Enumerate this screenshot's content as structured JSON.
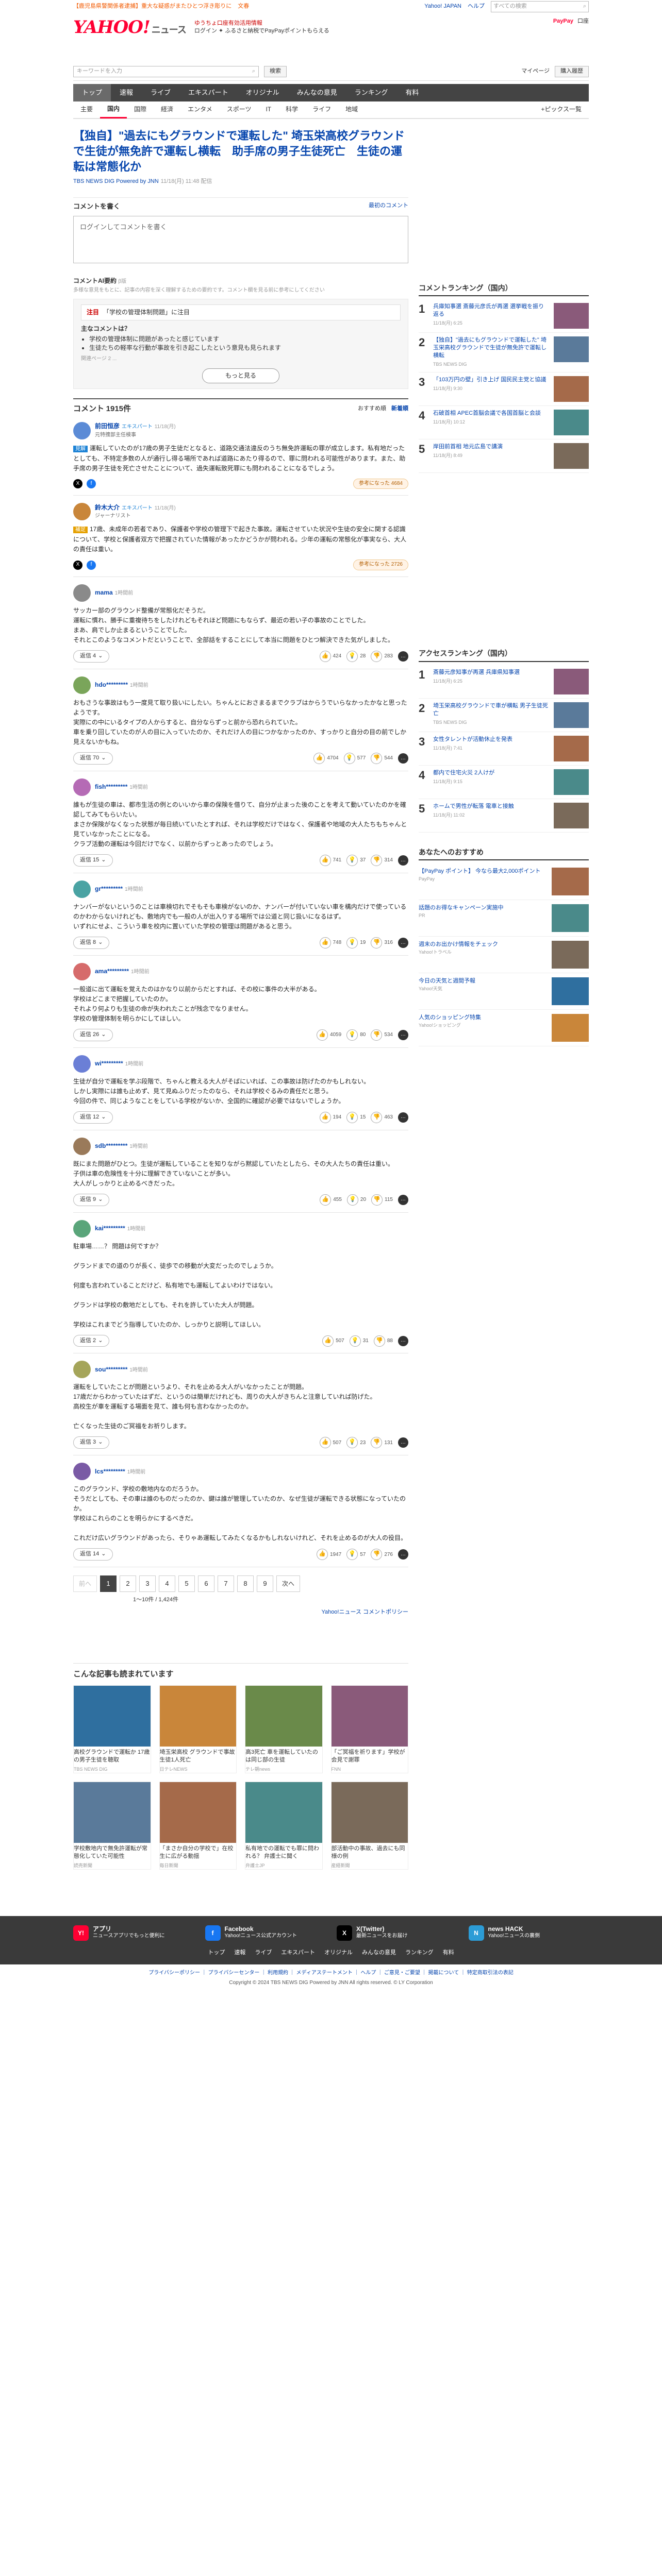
{
  "alert": {
    "items": [
      "【鹿児島県警関係者逮捕】重大な疑惑がまたひとつ浮き彫りに",
      "文春"
    ],
    "yj": "Yahoo! JAPAN",
    "help": "ヘルプ",
    "search_ph": "すべての検索"
  },
  "masthead": {
    "logo": "YAHOO!",
    "logo_sub": "ニュース",
    "promo1": "ゆうちょ口座有効活用情報",
    "promo2": "ログイン  ✦ ふるさと納税でPayPayポイントもらえる",
    "pp": "PayPay",
    "bank": "口座"
  },
  "tools": {
    "search_ph": "キーワードを入力",
    "search_btn": "検索",
    "mypage": "マイページ",
    "hist": "購入履歴"
  },
  "nav": [
    "トップ",
    "速報",
    "ライブ",
    "エキスパート",
    "オリジナル",
    "みんなの意見",
    "ランキング",
    "有料"
  ],
  "subnav": [
    "主要",
    "国内",
    "国際",
    "経済",
    "エンタメ",
    "スポーツ",
    "IT",
    "科学",
    "ライフ",
    "地域"
  ],
  "subnav_more": "+ピックス一覧",
  "article": {
    "title": "【独自】\"過去にもグラウンドで運転した\" 埼玉栄高校グラウンドで生徒が無免許で運転し横転　助手席の男子生徒死亡　生徒の運転は常態化か",
    "source": "TBS NEWS DIG Powered by JNN",
    "date": "11/18(月) 11:48 配信"
  },
  "comment_post": {
    "head": "コメントを書く",
    "rule": "最初のコメント",
    "placeholder": "ログインしてコメントを書く"
  },
  "ai": {
    "head": "コメントAI要約",
    "beta": "β版",
    "sub": "多様な意見をもとに、記事の内容を深く理解するための要約です。コメント欄を見る前に参考にしてください",
    "topic_label": "注目",
    "topic": "「学校の管理体制問題」に注目",
    "points_head": "主なコメントは？",
    "points": [
      "学校の管理体制に問題があったと感じています",
      "生徒たちの軽率な行動が事故を引き起こしたという意見も見られます"
    ],
    "note": "関連ページ 2 ...",
    "more": "もっと見る"
  },
  "comments_header": {
    "title": "コメント",
    "count": "1915件",
    "sort_recommend": "おすすめ順",
    "sort_new": "新着順"
  },
  "comments": [
    {
      "name": "前田恒彦",
      "badge": "エキスパート",
      "time": "11/18(月)",
      "role": "元特捜部主任検事",
      "tag": "見解",
      "text": "運転していたのが17歳の男子生徒だとなると、道路交通法違反のうち無免許運転の罪が成立します。私有地だったとしても、不特定多数の人が通行し得る場所であれば道路にあたり得るので、罪に問われる可能性があります。また、助手席の男子生徒を死亡させたことについて、過失運転致死罪にも問われることになるでしょう。",
      "exp": "専門家コメント",
      "up": "1",
      "mid": "",
      "down": "",
      "reply": "",
      "agree": "参考になった 4684"
    },
    {
      "name": "鈴木大介",
      "badge": "エキスパート",
      "time": "11/18(月)",
      "role": "ジャーナリスト",
      "tag": "補足",
      "text": "17歳、未成年の若者であり、保護者や学校の管理下で起きた事故。運転させていた状況や生徒の安全に関する認識について、学校と保護者双方で把握されていた情報があったかどうかが問われる。少年の運転の常態化が事実なら、大人の責任は重い。",
      "exp": "",
      "up": "",
      "mid": "",
      "down": "",
      "reply": "",
      "agree": "参考になった 2726"
    },
    {
      "name": "mama",
      "badge": "",
      "time": "1時間前",
      "role": "",
      "tag": "",
      "text": "サッカー部のグラウンド整備が常態化だそうだ。\n運転に慣れ、勝手に重複待ちをしたけれどもそれほど問題にもならず、最近の若い子の事故のことでした。\nまあ、肩でしか止まるということでした。\nそれとこのようなコメントだということで、全部話をすることにして本当に問題をひとつ解決できた気がしました。",
      "exp": "",
      "up": "424",
      "mid": "28",
      "down": "283",
      "reply": "返信 4",
      "agree": ""
    },
    {
      "name": "hdo*********",
      "badge": "",
      "time": "1時間前",
      "role": "",
      "tag": "",
      "text": "おもさうな事故はもう一度見て取り扱いにしたい。ちゃんとにおさまるまでクラブはからうでいらなかったかなと思ったようです。\n実際にの中にいるタイプの人からすると、自分ならずっと前から恐れられていた。\n車を乗り回していたのが人の目に入っていたのか、それだけ人の目につかなかったのか、すっかりと自分の目の前でしか見えないかもね。",
      "exp": "",
      "up": "4704",
      "mid": "577",
      "down": "544",
      "reply": "返信 70",
      "agree": ""
    },
    {
      "name": "fish*********",
      "badge": "",
      "time": "1時間前",
      "role": "",
      "tag": "",
      "text": "誰もが生徒の車は、都市生活の例とのいいから車の保険を借りて、自分が止まった後のことを考えて動いていたのかを確認してみてもらいたい。\nまさか保険がなくなった状態が毎日続いていたとすれば、それは学校だけではなく、保護者や地域の大人たちもちゃんと見ていなかったことになる。\nクラブ活動の運転は今回だけでなく、以前からずっとあったのでしょう。",
      "exp": "",
      "up": "741",
      "mid": "37",
      "down": "314",
      "reply": "返信 15",
      "agree": ""
    },
    {
      "name": "gr*********",
      "badge": "",
      "time": "1時間前",
      "role": "",
      "tag": "",
      "text": "ナンバーがないというのことは車検切れでそもそも車検がないのか、ナンバーが付いていない車を構内だけで使っているのかわからないけれども、敷地内でも一般の人が出入りする場所では公道と同じ扱いになるはず。\nいずれにせよ、こういう車を校内に置いていた学校の管理は問題があると思う。",
      "exp": "",
      "up": "748",
      "mid": "19",
      "down": "316",
      "reply": "返信 8",
      "agree": ""
    },
    {
      "name": "ama*********",
      "badge": "",
      "time": "1時間前",
      "role": "",
      "tag": "",
      "text": "一般道に出て運転を覚えたのはかなり以前からだとすれば、その校に事件の大半がある。\n学校はどこまで把握していたのか。\nそれより何よりも生徒の命が失われたことが残念でなりません。\n学校の管理体制を明らかにしてほしい。",
      "exp": "",
      "up": "4059",
      "mid": "80",
      "down": "534",
      "reply": "返信 26",
      "agree": ""
    },
    {
      "name": "wi*********",
      "badge": "",
      "time": "1時間前",
      "role": "",
      "tag": "",
      "text": "生徒が自分で運転を学ぶ段階で、ちゃんと教える大人がそばにいれば、この事故は防げたのかもしれない。\nしかし実際には誰も止めず、見て見ぬふりだったのなら、それは学校ぐるみの責任だと思う。\n今回の件で、同じようなことをしている学校がないか、全国的に確認が必要ではないでしょうか。",
      "exp": "",
      "up": "194",
      "mid": "15",
      "down": "463",
      "reply": "返信 12",
      "agree": ""
    },
    {
      "name": "sdb*********",
      "badge": "",
      "time": "1時間前",
      "role": "",
      "tag": "",
      "text": "既にまた問題がひとつ。生徒が運転していることを知りながら黙認していたとしたら、その大人たちの責任は重い。\n子供は車の危険性を十分に理解できていないことが多い。\n大人がしっかりと止めるべきだった。",
      "exp": "",
      "up": "455",
      "mid": "20",
      "down": "115",
      "reply": "返信 9",
      "agree": ""
    },
    {
      "name": "kai*********",
      "badge": "",
      "time": "1時間前",
      "role": "",
      "tag": "",
      "text": "駐車場……？ 問題は何ですか？\n\nグランドまでの道のりが長く、徒歩での移動が大変だったのでしょうか。\n\n何度も言われていることだけど、私有地でも運転してよいわけではない。\n\nグランドは学校の敷地だとしても、それを許していた大人が問題。\n\n学校はこれまでどう指導していたのか、しっかりと説明してほしい。",
      "exp": "",
      "up": "507",
      "mid": "31",
      "down": "88",
      "reply": "返信 2",
      "agree": ""
    },
    {
      "name": "sou*********",
      "badge": "",
      "time": "1時間前",
      "role": "",
      "tag": "",
      "text": "運転をしていたことが問題というより、それを止める大人がいなかったことが問題。\n17歳だからわかっていたはずだ、というのは簡単だけれども、周りの大人がきちんと注意していれば防げた。\n高校生が車を運転する場面を見て、誰も何も言わなかったのか。\n\n亡くなった生徒のご冥福をお祈りします。",
      "exp": "",
      "up": "507",
      "mid": "23",
      "down": "131",
      "reply": "返信 3",
      "agree": ""
    },
    {
      "name": "lcs*********",
      "badge": "",
      "time": "1時間前",
      "role": "",
      "tag": "",
      "text": "このグラウンド、学校の敷地内なのだろうか。\nそうだとしても、その車は誰のものだったのか、鍵は誰が管理していたのか、なぜ生徒が運転できる状態になっていたのか。\n学校はこれらのことを明らかにするべきだ。\n\nこれだけ広いグラウンドがあったら、そりゃあ運転してみたくなるかもしれないけれど、それを止めるのが大人の役目。",
      "exp": "",
      "up": "1947",
      "mid": "57",
      "down": "276",
      "reply": "返信 14",
      "agree": ""
    }
  ],
  "pager": {
    "prev": "前へ",
    "pages": [
      "1",
      "2",
      "3",
      "4",
      "5",
      "6",
      "7",
      "8",
      "9"
    ],
    "next": "次へ",
    "count": "1〜10件 / 1,424件",
    "ycom": "Yahoo!ニュース コメントポリシー"
  },
  "recommended": {
    "title": "こんな記事も読まれています",
    "items": [
      {
        "cap": "高校グラウンドで運転か 17歳の男子生徒を聴取",
        "src": "TBS NEWS DIG"
      },
      {
        "cap": "埼玉栄高校 グラウンドで事故 生徒1人死亡",
        "src": "日テレNEWS"
      },
      {
        "cap": "高3死亡 車を運転していたのは同じ部の生徒",
        "src": "テレ朝news"
      },
      {
        "cap": "「ご冥福を祈ります」学校が会見で謝罪",
        "src": "FNN"
      },
      {
        "cap": "学校敷地内で無免許運転が常態化していた可能性",
        "src": "読売新聞"
      },
      {
        "cap": "「まさか自分の学校で」在校生に広がる動揺",
        "src": "毎日新聞"
      },
      {
        "cap": "私有地での運転でも罪に問われる？ 弁護士に聞く",
        "src": "弁護士JP"
      },
      {
        "cap": "部活動中の事故、過去にも同様の例",
        "src": "産経新聞"
      }
    ]
  },
  "ranking": {
    "title": "コメントランキング（国内）",
    "items": [
      {
        "t": "兵庫知事選 斎藤元彦氏が再選 選挙戦を振り返る",
        "s": "11/18(月) 6:25"
      },
      {
        "t": "【独自】\"過去にもグラウンドで運転した\" 埼玉栄高校グラウンドで生徒が無免許で運転し横転",
        "s": "TBS NEWS DIG"
      },
      {
        "t": "「103万円の壁」引き上げ 国民民主党と協議",
        "s": "11/18(月) 9:30"
      },
      {
        "t": "石破首相 APEC首脳会議で各国首脳と会談",
        "s": "11/18(月) 10:12"
      },
      {
        "t": "岸田前首相 地元広島で講演",
        "s": "11/18(月) 8:49"
      }
    ]
  },
  "access": {
    "title": "アクセスランキング（国内）",
    "items": [
      {
        "t": "斎藤元彦知事が再選 兵庫県知事選",
        "s": "11/18(月) 6:25"
      },
      {
        "t": "埼玉栄高校グラウンドで車が横転 男子生徒死亡",
        "s": "TBS NEWS DIG"
      },
      {
        "t": "女性タレントが活動休止を発表",
        "s": "11/18(月) 7:41"
      },
      {
        "t": "都内で住宅火災 2人けが",
        "s": "11/18(月) 9:15"
      },
      {
        "t": "ホームで男性が転落 電車と接触",
        "s": "11/18(月) 11:02"
      }
    ]
  },
  "ads": {
    "title": "あなたへのおすすめ",
    "items": [
      {
        "t": "【PayPay ポイント】 今なら最大2,000ポイント",
        "s": "PayPay"
      },
      {
        "t": "話題のお得なキャンペーン実施中",
        "s": "PR"
      },
      {
        "t": "週末のお出かけ情報をチェック",
        "s": "Yahoo!トラベル"
      },
      {
        "t": "今日の天気と週間予報",
        "s": "Yahoo!天気"
      },
      {
        "t": "人気のショッピング特集",
        "s": "Yahoo!ショッピング"
      }
    ]
  },
  "footer": {
    "cols": [
      {
        "h": "アプリ",
        "t": "ニュースアプリでもっと便利に",
        "ic": "Y!",
        "c": "#ff0033"
      },
      {
        "h": "Facebook",
        "t": "Yahoo!ニュース公式アカウント",
        "ic": "f",
        "c": "#1877f2"
      },
      {
        "h": "X(Twitter)",
        "t": "最新ニュースをお届け",
        "ic": "X",
        "c": "#000"
      },
      {
        "h": "news HACK",
        "t": "Yahoo!ニュースの裏側",
        "ic": "N",
        "c": "#2c9cd6"
      }
    ],
    "nav": [
      "トップ",
      "速報",
      "ライブ",
      "エキスパート",
      "オリジナル",
      "みんなの意見",
      "ランキング",
      "有料",
      "主要",
      "国内",
      "国際",
      "経済",
      "エンタメ",
      "スポーツ",
      "IT",
      "科学",
      "ライフ",
      "地域"
    ],
    "legal": "プライバシーポリシー ｜ プライバシーセンター ｜ 利用規約 ｜ メディアステートメント ｜ ヘルプ ｜ ご意見・ご要望 ｜ 掲載について ｜ 特定商取引法の表記",
    "copy": "Copyright © 2024 TBS NEWS DIG Powered by JNN All rights reserved. © LY Corporation"
  }
}
